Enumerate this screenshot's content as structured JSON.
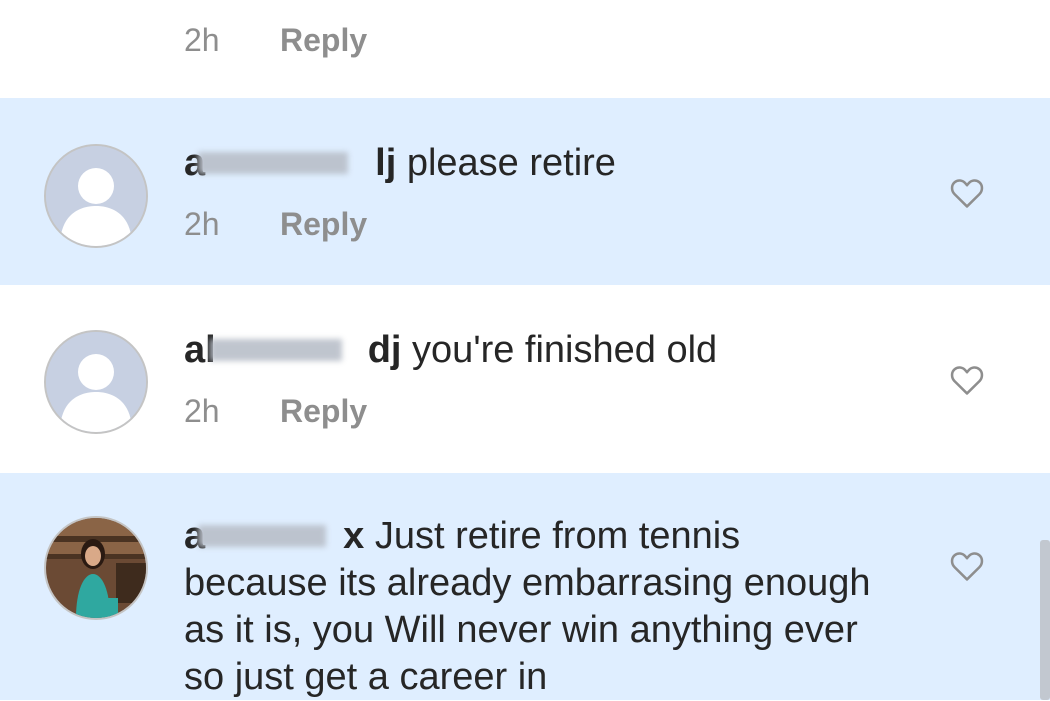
{
  "top_item": {
    "time": "2h",
    "reply_label": "Reply"
  },
  "comments": [
    {
      "username_start": "a",
      "username_end": "lj",
      "text": "please retire",
      "time": "2h",
      "reply_label": "Reply",
      "highlighted": true,
      "avatar": "default-avatar"
    },
    {
      "username_start": "al",
      "username_end": "dj",
      "text": "you're finished old",
      "time": "2h",
      "reply_label": "Reply",
      "highlighted": false,
      "avatar": "default-avatar"
    },
    {
      "username_start": "a",
      "username_end": "x",
      "text": "Just retire from tennis because its already embarrasing enough as it is, you Will never win anything ever so just get a career in",
      "highlighted": true,
      "avatar": "photo-avatar"
    }
  ],
  "colors": {
    "highlight": "#dfeeff",
    "meta_text": "#8e8e8e",
    "body_text": "#262626"
  },
  "icons": {
    "like": "heart-outline-icon",
    "avatar": "person-silhouette-icon"
  }
}
